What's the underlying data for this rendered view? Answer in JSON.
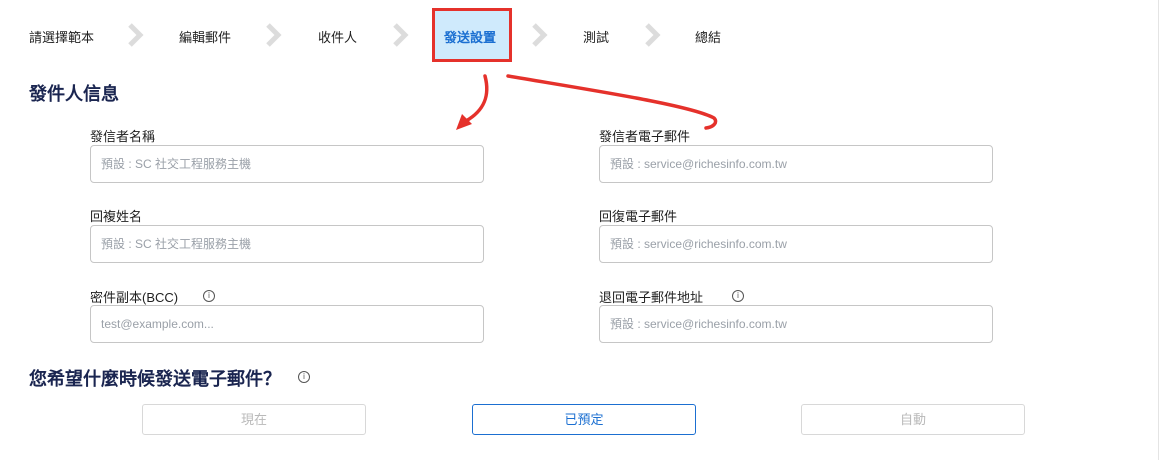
{
  "stepper": {
    "steps": [
      {
        "label": "請選擇範本"
      },
      {
        "label": "編輯郵件"
      },
      {
        "label": "收件人"
      },
      {
        "label": "發送設置"
      },
      {
        "label": "測試"
      },
      {
        "label": "總結"
      }
    ],
    "active_index": 3
  },
  "sender_section": {
    "title": "發件人信息",
    "sender_name": {
      "label": "發信者名稱",
      "placeholder": "預設 : SC 社交工程服務主機",
      "value": ""
    },
    "sender_email": {
      "label": "發信者電子郵件",
      "placeholder": "預設 : service@richesinfo.com.tw",
      "value": ""
    },
    "reply_name": {
      "label": "回複姓名",
      "placeholder": "預設 : SC 社交工程服務主機",
      "value": ""
    },
    "reply_email": {
      "label": "回復電子郵件",
      "placeholder": "預設 : service@richesinfo.com.tw",
      "value": ""
    },
    "bcc": {
      "label": "密件副本(BCC)",
      "placeholder": "test@example.com...",
      "value": ""
    },
    "bounce_email": {
      "label": "退回電子郵件地址",
      "placeholder": "預設 : service@richesinfo.com.tw",
      "value": ""
    }
  },
  "schedule_section": {
    "title": "您希望什麼時候發送電子郵件？",
    "options": [
      {
        "label": "現在",
        "state": "disabled"
      },
      {
        "label": "已預定",
        "state": "selected"
      },
      {
        "label": "自動",
        "state": "disabled"
      }
    ]
  },
  "icons": {
    "chevron": "chevron-right-icon",
    "info": "info-icon",
    "annotation": "red-arrow-annotation"
  },
  "colors": {
    "accent": "#1b6fd1",
    "active_bg": "#cfeafc",
    "annotation_red": "#e5312b",
    "title": "#1a2550"
  }
}
